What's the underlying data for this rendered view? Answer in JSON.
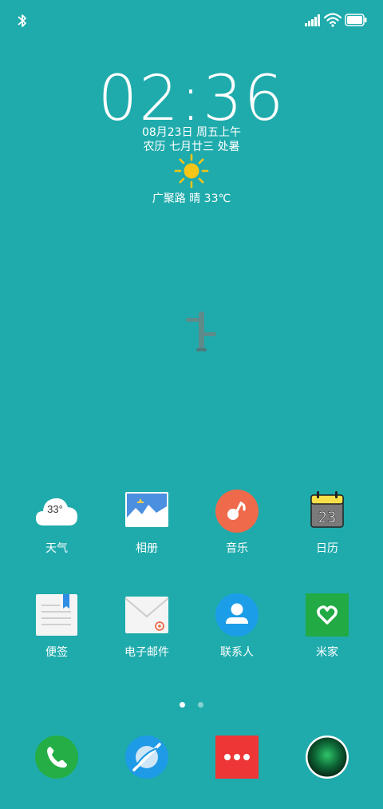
{
  "status_bar": {
    "left_icons": [
      "bluetooth-icon"
    ],
    "right_icons": [
      "signal-icon",
      "wifi-icon",
      "battery-icon"
    ]
  },
  "clock_widget": {
    "time": "02:36",
    "date": "08月23日 周五上午",
    "lunar": "农历 七月廿三 处暑",
    "weather_icon": "sun-icon",
    "weather": "广聚路 晴 33℃"
  },
  "apps_row1": [
    {
      "label": "天气",
      "icon": "weather-icon",
      "badge": "33°"
    },
    {
      "label": "相册",
      "icon": "gallery-icon"
    },
    {
      "label": "音乐",
      "icon": "music-icon"
    },
    {
      "label": "日历",
      "icon": "calendar-icon",
      "badge": "23"
    }
  ],
  "apps_row2": [
    {
      "label": "便签",
      "icon": "notes-icon"
    },
    {
      "label": "电子邮件",
      "icon": "email-icon"
    },
    {
      "label": "联系人",
      "icon": "contacts-icon"
    },
    {
      "label": "米家",
      "icon": "mijia-icon"
    }
  ],
  "page_indicator": {
    "pages": 2,
    "current": 1
  },
  "dock": [
    {
      "icon": "phone-icon"
    },
    {
      "icon": "browser-icon"
    },
    {
      "icon": "more-apps-icon"
    },
    {
      "icon": "camera-icon"
    }
  ],
  "colors": {
    "background": "#1fabac",
    "music": "#ef6a4a",
    "contacts": "#1c9de8",
    "mijia": "#22aa44",
    "phone": "#25ae45",
    "browser": "#1e9ae6",
    "more": "#ef3636"
  }
}
